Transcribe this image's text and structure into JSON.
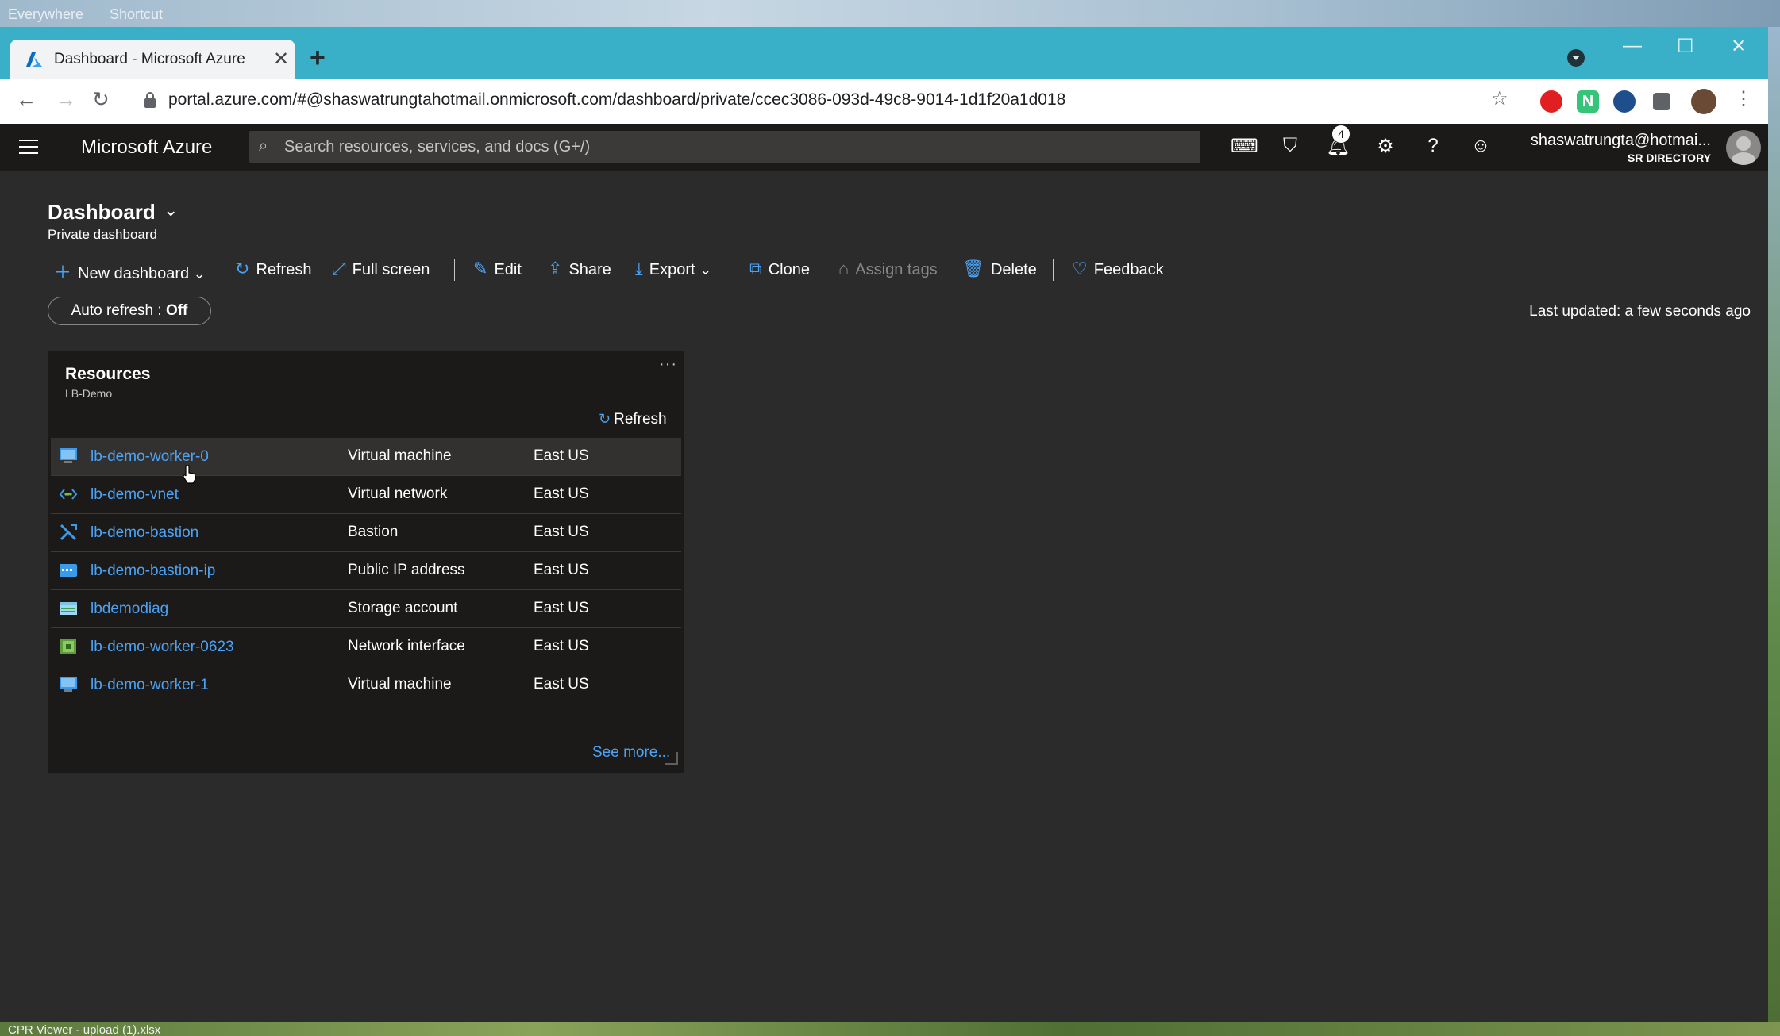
{
  "desktop": {
    "top_items": [
      "Everywhere",
      "Shortcut"
    ],
    "bottom_item": "CPR Viewer - upload (1).xlsx"
  },
  "browser": {
    "tab_title": "Dashboard - Microsoft Azure",
    "url": "portal.azure.com/#@shaswatrungtahotmail.onmicrosoft.com/dashboard/private/ccec3086-093d-49c8-9014-1d1f20a1d018",
    "tab_bg": "#3ab0c8"
  },
  "azure": {
    "brand": "Microsoft Azure",
    "search_placeholder": "Search resources, services, and docs (G+/)",
    "notifications_count": "4",
    "user_email": "shaswatrungta@hotmai...",
    "user_directory": "SR DIRECTORY"
  },
  "dashboard": {
    "title": "Dashboard",
    "subtitle": "Private dashboard",
    "commands": {
      "new_dashboard": "New dashboard",
      "refresh": "Refresh",
      "full_screen": "Full screen",
      "edit": "Edit",
      "share": "Share",
      "export": "Export",
      "clone": "Clone",
      "assign_tags": "Assign tags",
      "delete": "Delete",
      "feedback": "Feedback"
    },
    "auto_refresh_label": "Auto refresh : ",
    "auto_refresh_value": "Off",
    "last_updated": "Last updated: a few seconds ago"
  },
  "tile": {
    "title": "Resources",
    "subtitle": "LB-Demo",
    "refresh": "Refresh",
    "see_more": "See more...",
    "rows": [
      {
        "name": "lb-demo-worker-0",
        "type": "Virtual machine",
        "location": "East US",
        "icon": "virtual-machine-icon"
      },
      {
        "name": "lb-demo-vnet",
        "type": "Virtual network",
        "location": "East US",
        "icon": "virtual-network-icon"
      },
      {
        "name": "lb-demo-bastion",
        "type": "Bastion",
        "location": "East US",
        "icon": "bastion-icon"
      },
      {
        "name": "lb-demo-bastion-ip",
        "type": "Public IP address",
        "location": "East US",
        "icon": "public-ip-icon"
      },
      {
        "name": "lbdemodiag",
        "type": "Storage account",
        "location": "East US",
        "icon": "storage-account-icon"
      },
      {
        "name": "lb-demo-worker-0623",
        "type": "Network interface",
        "location": "East US",
        "icon": "network-interface-icon"
      },
      {
        "name": "lb-demo-worker-1",
        "type": "Virtual machine",
        "location": "East US",
        "icon": "virtual-machine-icon"
      }
    ]
  },
  "colors": {
    "accent": "#4ca3f5",
    "portal_bg": "#2b2b2b",
    "topbar_bg": "#1b1a19"
  }
}
